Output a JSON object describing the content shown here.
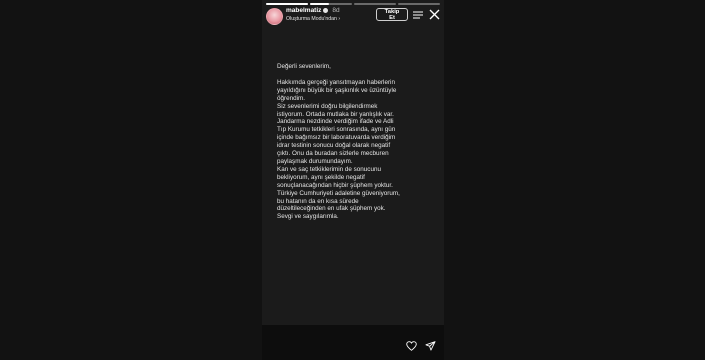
{
  "story": {
    "username": "mabelmatiz",
    "time_ago": "8d",
    "subtitle": "Oluşturma Modu'ndan ›",
    "follow_label": "Takip Et",
    "progress": [
      1,
      0.45,
      0,
      0
    ]
  },
  "content": {
    "greeting": "Değerli sevenlerim,",
    "lines": [
      "Hakkımda gerçeği yansıtmayan haberlerin",
      "yayıldığını büyük bir şaşkınlık ve üzüntüyle",
      "öğrendim.",
      "Siz sevenlerimi doğru bilgilendirmek",
      "istiyorum. Ortada mutlaka bir yanlışlık var.",
      "Jandarma nezdinde verdiğim ifade ve Adli",
      "Tıp Kurumu tetkikleri sonrasında, aynı gün",
      "içinde bağımsız bir laboratuvarda verdiğim",
      "idrar testinin sonucu doğal olarak negatif",
      "çıktı. Onu da buradan sizlerle mecburen",
      "paylaşmak durumundayım.",
      "Kan ve saç tetkiklerimin de sonucunu",
      "bekliyorum, aynı şekilde negatif",
      "sonuçlanacağından hiçbir şüphem yoktur.",
      "Türkiye Cumhuriyeti adaletine güveniyorum,",
      "bu hatanın da en kısa sürede",
      "düzeltileceğinden en ufak şüphem yok.",
      "Sevgi ve saygılarımla."
    ]
  },
  "colors": {
    "background": "#0d0d0d",
    "story_bg": "#1b1b1b",
    "text": "#e6e6e6"
  },
  "icons": [
    "menu-icon",
    "close-icon",
    "heart-icon",
    "send-icon",
    "verified-icon"
  ]
}
